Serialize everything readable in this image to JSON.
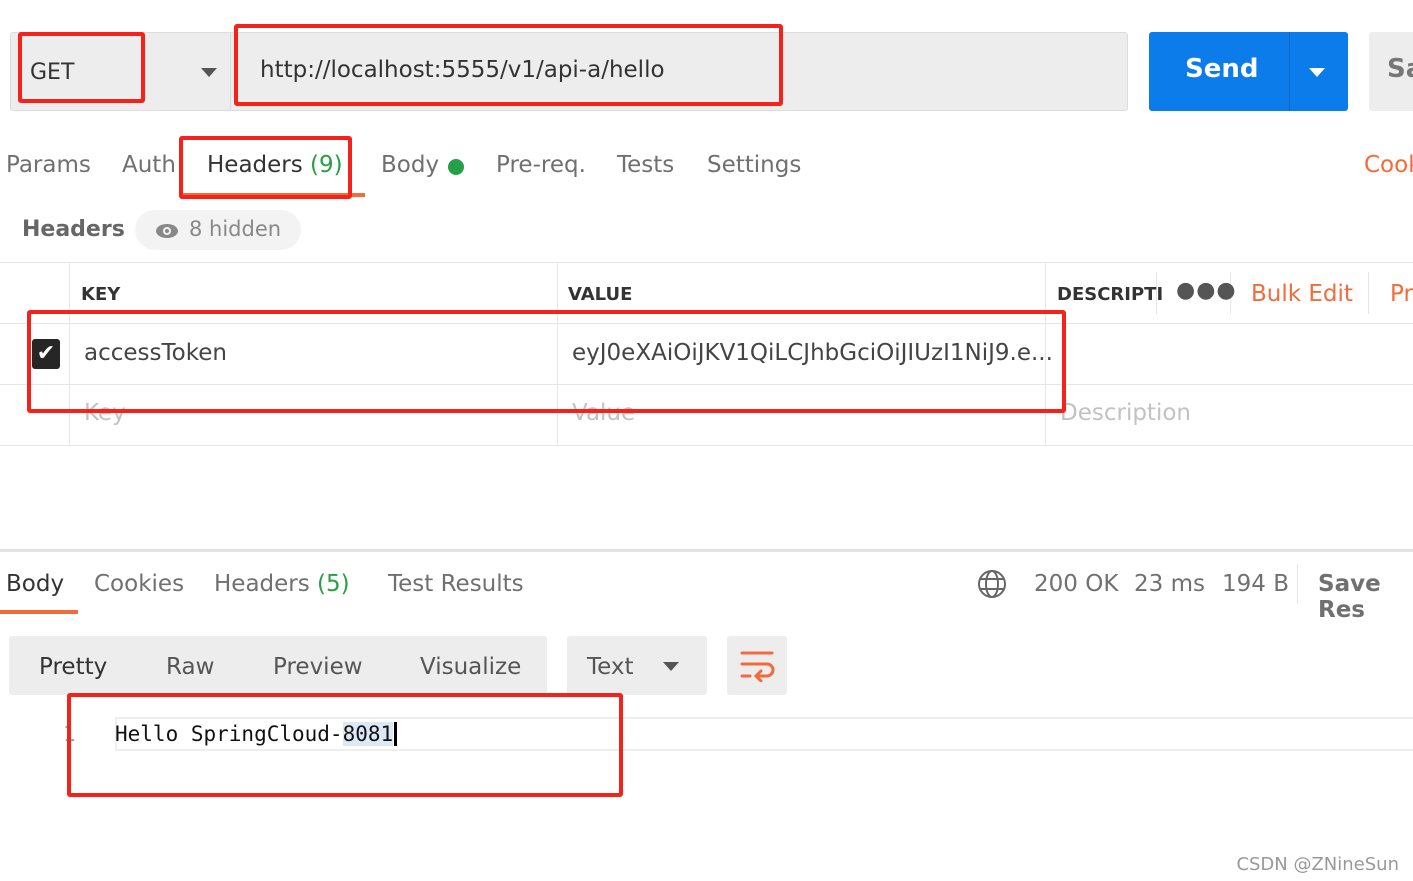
{
  "request": {
    "method": "GET",
    "url": "http://localhost:5555/v1/api-a/hello",
    "send_label": "Send",
    "save_label": "Sa"
  },
  "tabs": [
    {
      "label": "Params"
    },
    {
      "label": "Auth"
    },
    {
      "label": "Headers",
      "count": "(9)",
      "active": true
    },
    {
      "label": "Body",
      "dot_color": "#26a047"
    },
    {
      "label": "Pre-req."
    },
    {
      "label": "Tests"
    },
    {
      "label": "Settings"
    }
  ],
  "cookies_label": "Cook",
  "headers_section": {
    "title": "Headers",
    "hidden_label": "8 hidden"
  },
  "table": {
    "columns": [
      "KEY",
      "VALUE",
      "DESCRIPTI"
    ],
    "bulk_edit": "Bulk Edit",
    "presets": "Pr",
    "rows": [
      {
        "checked": true,
        "key": "accessToken",
        "value": "eyJ0eXAiOiJKV1QiLCJhbGciOiJIUzI1NiJ9.e..."
      }
    ],
    "placeholders": {
      "key": "Key",
      "value": "Value",
      "description": "Description"
    }
  },
  "response": {
    "tabs": [
      {
        "label": "Body",
        "active": true
      },
      {
        "label": "Cookies"
      },
      {
        "label": "Headers",
        "count": "(5)"
      },
      {
        "label": "Test Results"
      }
    ],
    "status": "200 OK",
    "time": "23 ms",
    "size": "194 B",
    "save_label": "Save Res",
    "view_modes": [
      "Pretty",
      "Raw",
      "Preview",
      "Visualize"
    ],
    "format": "Text",
    "lines": [
      {
        "number": "1",
        "text": "Hello SpringCloud-",
        "selected": "8081"
      }
    ]
  },
  "colors": {
    "accent": "#0b7ce9",
    "orange": "#f26b3a",
    "green": "#26a047",
    "annotation": "#f5221b"
  },
  "watermark": "CSDN @ZNineSun"
}
